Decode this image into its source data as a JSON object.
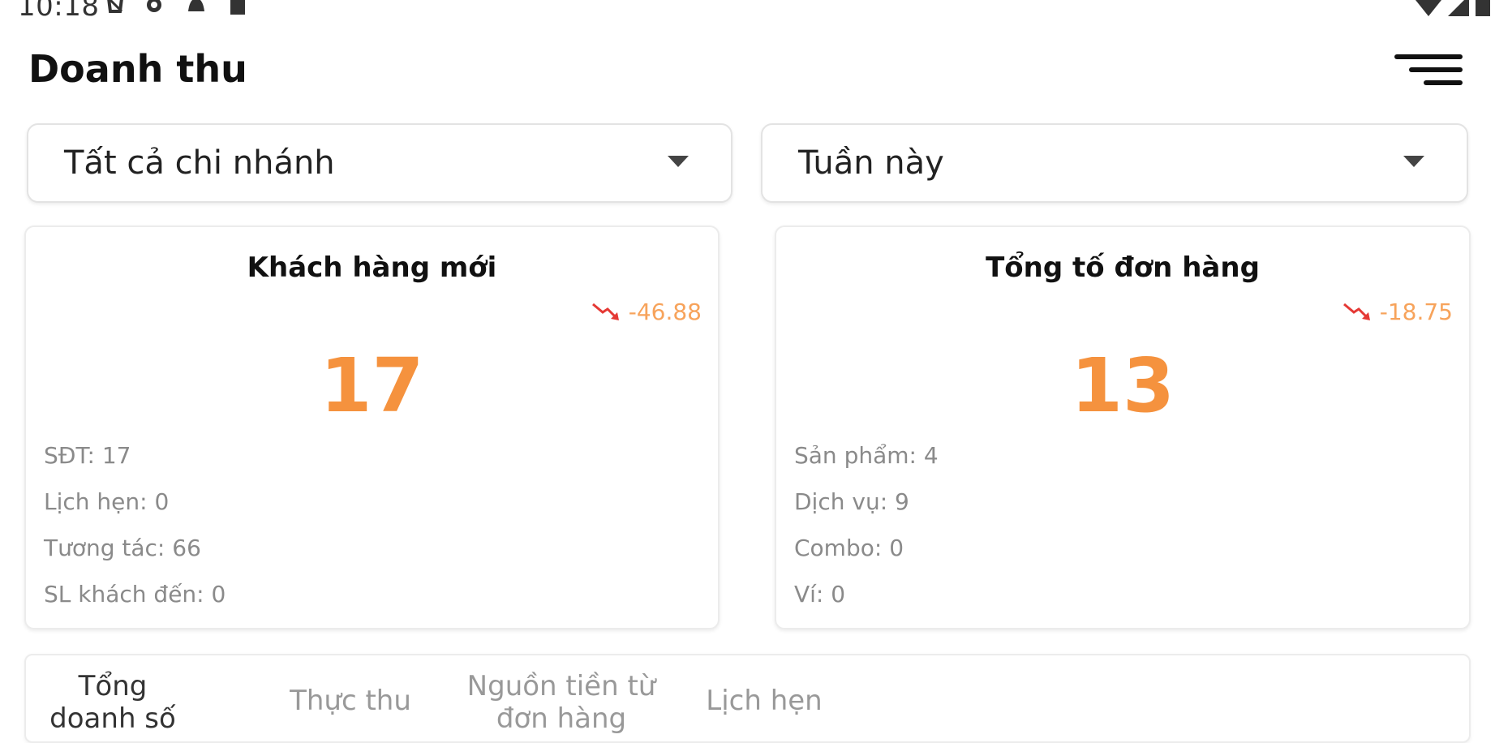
{
  "status_bar": {
    "time": "10:18",
    "icons": [
      "notification-icon",
      "gear-icon",
      "bell-icon",
      "sd-card-icon"
    ],
    "right_icons": [
      "wifi-icon",
      "signal-icon",
      "battery-icon"
    ]
  },
  "header": {
    "title": "Doanh thu",
    "menu_icon": "menu-icon"
  },
  "filters": {
    "branch": "Tất cả chi nhánh",
    "period": "Tuần này"
  },
  "cards": [
    {
      "title": "Khách hàng mới",
      "trend": "-46.88",
      "trend_direction": "down",
      "value": "17",
      "details": [
        "SĐT: 17",
        "Lịch hẹn: 0",
        "Tương tác: 66",
        "SL khách đến: 0"
      ]
    },
    {
      "title": "Tổng tố đơn hàng",
      "trend": "-18.75",
      "trend_direction": "down",
      "value": "13",
      "details": [
        "Sản phẩm: 4",
        "Dịch vụ: 9",
        "Combo: 0",
        "Ví: 0"
      ]
    }
  ],
  "tabs": [
    {
      "label": "Tổng doanh số",
      "active": true
    },
    {
      "label": "Thực thu",
      "active": false
    },
    {
      "label": "Nguồn tiền từ đơn hàng",
      "active": false
    },
    {
      "label": "Lịch hẹn",
      "active": false
    }
  ],
  "colors": {
    "accent": "#f5923e",
    "trend_text": "#f7a35b",
    "trend_icon": "#e53935"
  }
}
